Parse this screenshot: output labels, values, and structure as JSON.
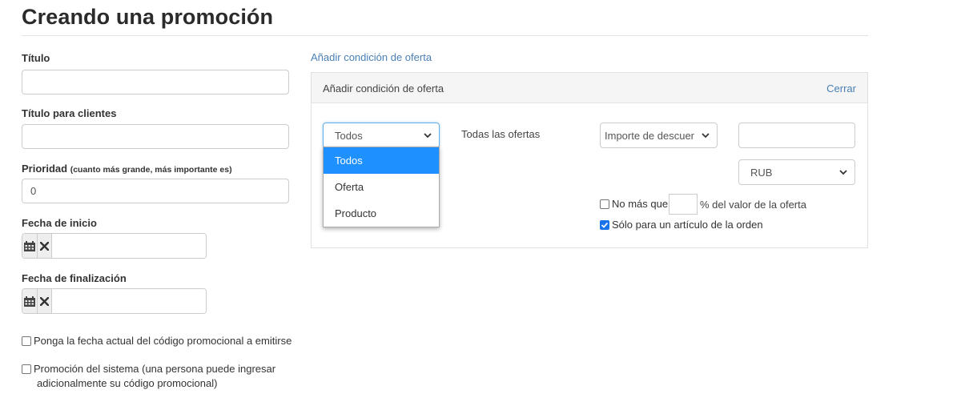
{
  "page": {
    "title": "Creando una promoción"
  },
  "form": {
    "titulo_label": "Título",
    "titulo_value": "",
    "titulo_clientes_label": "Título para clientes",
    "titulo_clientes_value": "",
    "prioridad_label": "Prioridad",
    "prioridad_hint": "(cuanto más grande, más importante es)",
    "prioridad_value": "0",
    "fecha_inicio_label": "Fecha de inicio",
    "fecha_fin_label": "Fecha de finalización",
    "checkbox_fecha_actual": "Ponga la fecha actual del código promocional a emitirse",
    "checkbox_promo_sistema_line1": "Promoción del sistema (una persona puede ingresar",
    "checkbox_promo_sistema_line2": "adicionalmente su código promocional)"
  },
  "condition": {
    "add_link": "Añadir condición de oferta",
    "panel_title": "Añadir condición de oferta",
    "close_label": "Cerrar",
    "scope_select": {
      "value": "Todos",
      "options": [
        "Todos",
        "Oferta",
        "Producto"
      ],
      "highlighted": "Todos"
    },
    "all_offers_text": "Todas las ofertas",
    "discount_type_select": {
      "value": "Importe de descuer"
    },
    "amount_value": "",
    "currency_select": {
      "value": "RUB"
    },
    "no_more_than_label": "No más que",
    "no_more_than_value": "",
    "percent_suffix": "% del valor de la oferta",
    "only_one_item_label": "Sólo para un artículo de la orden",
    "only_one_item_checked": true,
    "no_more_than_checked": false
  },
  "colors": {
    "link": "#4a7fb5",
    "highlight": "#1e90ff",
    "checkbox": "#1a73e8"
  }
}
